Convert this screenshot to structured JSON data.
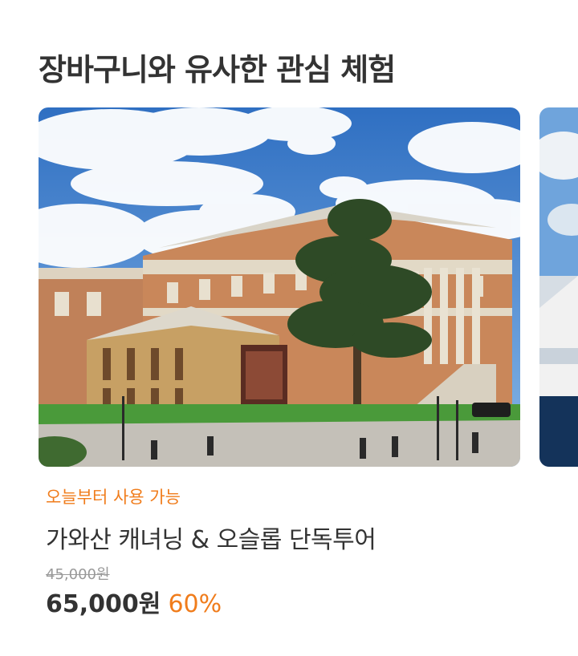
{
  "section": {
    "title": "장바구니와 유사한 관심 체험"
  },
  "products": [
    {
      "image_alt": "museum-photo",
      "availability": "오늘부터 사용 가능",
      "title": "가와산 캐녀닝 & 오슬롭  단독투어",
      "original_price": "45,000원",
      "sale_price": "65,000원",
      "discount": "60%"
    }
  ],
  "colors": {
    "accent": "#f07c1b",
    "text": "#333333",
    "muted": "#999999"
  }
}
